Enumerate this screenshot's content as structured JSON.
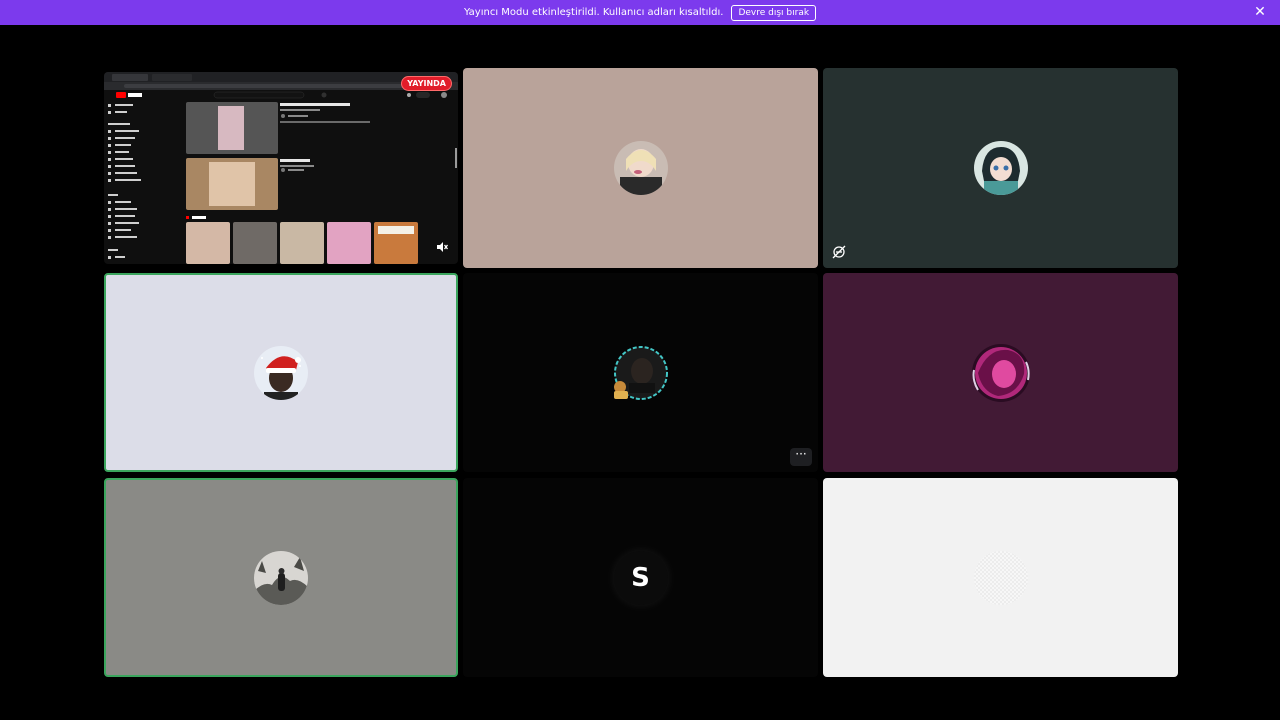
{
  "banner": {
    "message": "Yayıncı Modu etkinleştirildi. Kullanıcı adları kısaltıldı.",
    "disable_button": "Devre dışı bırak",
    "close_glyph": "✕",
    "color": "#7c3aed"
  },
  "screen_share": {
    "live_badge": "YAYINDA",
    "volume_icon": "volume-muted-icon",
    "muted_glyph": "🔇"
  },
  "tiles": {
    "top_middle_bg": "#b9a39a",
    "top_right_bg": "#263130",
    "middle_left_bg": "#dcdde8",
    "middle_middle_bg": "#050505",
    "middle_right_bg": "#421a35",
    "bottom_left_bg": "#8a8a86",
    "bottom_middle_bg": "#050505",
    "bottom_right_bg": "#f2f2f2",
    "speaking_color": "#3ba55d"
  },
  "more_options_glyph": "···",
  "s_avatar_letter": "S"
}
